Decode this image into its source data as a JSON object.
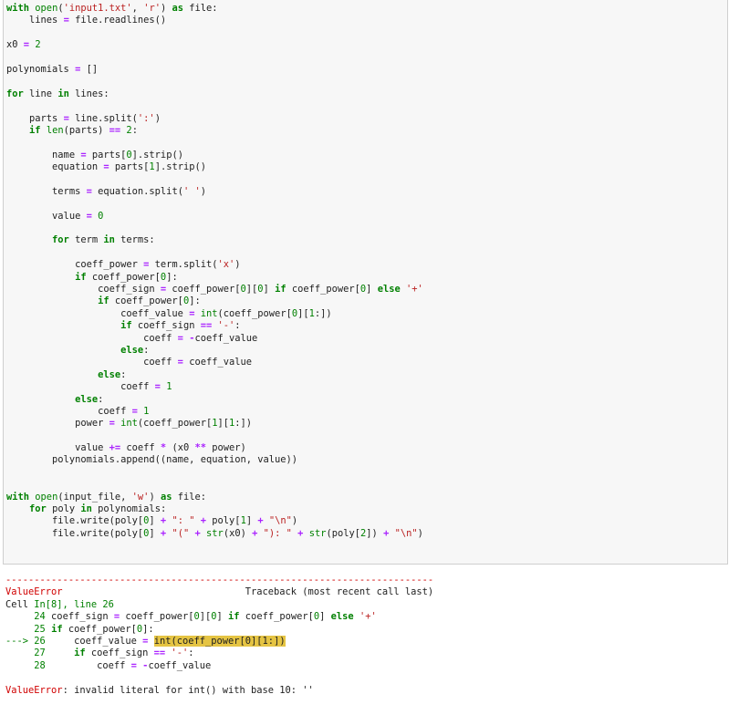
{
  "code_cell": {
    "lines": [
      [
        {
          "t": "kw",
          "v": "with"
        },
        {
          "t": "pl",
          "v": " "
        },
        {
          "t": "bi",
          "v": "open"
        },
        {
          "t": "pl",
          "v": "("
        },
        {
          "t": "str",
          "v": "'input1.txt'"
        },
        {
          "t": "pl",
          "v": ", "
        },
        {
          "t": "str",
          "v": "'r'"
        },
        {
          "t": "pl",
          "v": ") "
        },
        {
          "t": "kw",
          "v": "as"
        },
        {
          "t": "pl",
          "v": " file:"
        }
      ],
      [
        {
          "t": "pl",
          "v": "    lines "
        },
        {
          "t": "op",
          "v": "="
        },
        {
          "t": "pl",
          "v": " file.readlines()"
        }
      ],
      [],
      [
        {
          "t": "pl",
          "v": "x0 "
        },
        {
          "t": "op",
          "v": "="
        },
        {
          "t": "pl",
          "v": " "
        },
        {
          "t": "num",
          "v": "2"
        }
      ],
      [],
      [
        {
          "t": "pl",
          "v": "polynomials "
        },
        {
          "t": "op",
          "v": "="
        },
        {
          "t": "pl",
          "v": " []"
        }
      ],
      [],
      [
        {
          "t": "kw",
          "v": "for"
        },
        {
          "t": "pl",
          "v": " line "
        },
        {
          "t": "kw",
          "v": "in"
        },
        {
          "t": "pl",
          "v": " lines:"
        }
      ],
      [],
      [
        {
          "t": "pl",
          "v": "    parts "
        },
        {
          "t": "op",
          "v": "="
        },
        {
          "t": "pl",
          "v": " line.split("
        },
        {
          "t": "str",
          "v": "':'"
        },
        {
          "t": "pl",
          "v": ")"
        }
      ],
      [
        {
          "t": "pl",
          "v": "    "
        },
        {
          "t": "kw",
          "v": "if"
        },
        {
          "t": "pl",
          "v": " "
        },
        {
          "t": "bi",
          "v": "len"
        },
        {
          "t": "pl",
          "v": "(parts) "
        },
        {
          "t": "op",
          "v": "=="
        },
        {
          "t": "pl",
          "v": " "
        },
        {
          "t": "num",
          "v": "2"
        },
        {
          "t": "pl",
          "v": ":"
        }
      ],
      [],
      [
        {
          "t": "pl",
          "v": "        name "
        },
        {
          "t": "op",
          "v": "="
        },
        {
          "t": "pl",
          "v": " parts["
        },
        {
          "t": "num",
          "v": "0"
        },
        {
          "t": "pl",
          "v": "].strip()"
        }
      ],
      [
        {
          "t": "pl",
          "v": "        equation "
        },
        {
          "t": "op",
          "v": "="
        },
        {
          "t": "pl",
          "v": " parts["
        },
        {
          "t": "num",
          "v": "1"
        },
        {
          "t": "pl",
          "v": "].strip()"
        }
      ],
      [],
      [
        {
          "t": "pl",
          "v": "        terms "
        },
        {
          "t": "op",
          "v": "="
        },
        {
          "t": "pl",
          "v": " equation.split("
        },
        {
          "t": "str",
          "v": "' '"
        },
        {
          "t": "pl",
          "v": ")"
        }
      ],
      [],
      [
        {
          "t": "pl",
          "v": "        value "
        },
        {
          "t": "op",
          "v": "="
        },
        {
          "t": "pl",
          "v": " "
        },
        {
          "t": "num",
          "v": "0"
        }
      ],
      [],
      [
        {
          "t": "pl",
          "v": "        "
        },
        {
          "t": "kw",
          "v": "for"
        },
        {
          "t": "pl",
          "v": " term "
        },
        {
          "t": "kw",
          "v": "in"
        },
        {
          "t": "pl",
          "v": " terms:"
        }
      ],
      [],
      [
        {
          "t": "pl",
          "v": "            coeff_power "
        },
        {
          "t": "op",
          "v": "="
        },
        {
          "t": "pl",
          "v": " term.split("
        },
        {
          "t": "str",
          "v": "'x'"
        },
        {
          "t": "pl",
          "v": ")"
        }
      ],
      [
        {
          "t": "pl",
          "v": "            "
        },
        {
          "t": "kw",
          "v": "if"
        },
        {
          "t": "pl",
          "v": " coeff_power["
        },
        {
          "t": "num",
          "v": "0"
        },
        {
          "t": "pl",
          "v": "]:"
        }
      ],
      [
        {
          "t": "pl",
          "v": "                coeff_sign "
        },
        {
          "t": "op",
          "v": "="
        },
        {
          "t": "pl",
          "v": " coeff_power["
        },
        {
          "t": "num",
          "v": "0"
        },
        {
          "t": "pl",
          "v": "]["
        },
        {
          "t": "num",
          "v": "0"
        },
        {
          "t": "pl",
          "v": "] "
        },
        {
          "t": "kw",
          "v": "if"
        },
        {
          "t": "pl",
          "v": " coeff_power["
        },
        {
          "t": "num",
          "v": "0"
        },
        {
          "t": "pl",
          "v": "] "
        },
        {
          "t": "kw",
          "v": "else"
        },
        {
          "t": "pl",
          "v": " "
        },
        {
          "t": "str",
          "v": "'+'"
        }
      ],
      [
        {
          "t": "pl",
          "v": "                "
        },
        {
          "t": "kw",
          "v": "if"
        },
        {
          "t": "pl",
          "v": " coeff_power["
        },
        {
          "t": "num",
          "v": "0"
        },
        {
          "t": "pl",
          "v": "]:"
        }
      ],
      [
        {
          "t": "pl",
          "v": "                    coeff_value "
        },
        {
          "t": "op",
          "v": "="
        },
        {
          "t": "pl",
          "v": " "
        },
        {
          "t": "bi",
          "v": "int"
        },
        {
          "t": "pl",
          "v": "(coeff_power["
        },
        {
          "t": "num",
          "v": "0"
        },
        {
          "t": "pl",
          "v": "]["
        },
        {
          "t": "num",
          "v": "1"
        },
        {
          "t": "pl",
          "v": ":])"
        }
      ],
      [
        {
          "t": "pl",
          "v": "                    "
        },
        {
          "t": "kw",
          "v": "if"
        },
        {
          "t": "pl",
          "v": " coeff_sign "
        },
        {
          "t": "op",
          "v": "=="
        },
        {
          "t": "pl",
          "v": " "
        },
        {
          "t": "str",
          "v": "'-'"
        },
        {
          "t": "pl",
          "v": ":"
        }
      ],
      [
        {
          "t": "pl",
          "v": "                        coeff "
        },
        {
          "t": "op",
          "v": "="
        },
        {
          "t": "pl",
          "v": " "
        },
        {
          "t": "op",
          "v": "-"
        },
        {
          "t": "pl",
          "v": "coeff_value"
        }
      ],
      [
        {
          "t": "pl",
          "v": "                    "
        },
        {
          "t": "kw",
          "v": "else"
        },
        {
          "t": "pl",
          "v": ":"
        }
      ],
      [
        {
          "t": "pl",
          "v": "                        coeff "
        },
        {
          "t": "op",
          "v": "="
        },
        {
          "t": "pl",
          "v": " coeff_value"
        }
      ],
      [
        {
          "t": "pl",
          "v": "                "
        },
        {
          "t": "kw",
          "v": "else"
        },
        {
          "t": "pl",
          "v": ":"
        }
      ],
      [
        {
          "t": "pl",
          "v": "                    coeff "
        },
        {
          "t": "op",
          "v": "="
        },
        {
          "t": "pl",
          "v": " "
        },
        {
          "t": "num",
          "v": "1"
        }
      ],
      [
        {
          "t": "pl",
          "v": "            "
        },
        {
          "t": "kw",
          "v": "else"
        },
        {
          "t": "pl",
          "v": ":"
        }
      ],
      [
        {
          "t": "pl",
          "v": "                coeff "
        },
        {
          "t": "op",
          "v": "="
        },
        {
          "t": "pl",
          "v": " "
        },
        {
          "t": "num",
          "v": "1"
        }
      ],
      [
        {
          "t": "pl",
          "v": "            power "
        },
        {
          "t": "op",
          "v": "="
        },
        {
          "t": "pl",
          "v": " "
        },
        {
          "t": "bi",
          "v": "int"
        },
        {
          "t": "pl",
          "v": "(coeff_power["
        },
        {
          "t": "num",
          "v": "1"
        },
        {
          "t": "pl",
          "v": "]["
        },
        {
          "t": "num",
          "v": "1"
        },
        {
          "t": "pl",
          "v": ":])"
        }
      ],
      [],
      [
        {
          "t": "pl",
          "v": "            value "
        },
        {
          "t": "op",
          "v": "+="
        },
        {
          "t": "pl",
          "v": " coeff "
        },
        {
          "t": "op",
          "v": "*"
        },
        {
          "t": "pl",
          "v": " (x0 "
        },
        {
          "t": "op",
          "v": "**"
        },
        {
          "t": "pl",
          "v": " power)"
        }
      ],
      [
        {
          "t": "pl",
          "v": "        polynomials.append((name, equation, value))"
        }
      ],
      [],
      [],
      [
        {
          "t": "kw",
          "v": "with"
        },
        {
          "t": "pl",
          "v": " "
        },
        {
          "t": "bi",
          "v": "open"
        },
        {
          "t": "pl",
          "v": "(input_file, "
        },
        {
          "t": "str",
          "v": "'w'"
        },
        {
          "t": "pl",
          "v": ") "
        },
        {
          "t": "kw",
          "v": "as"
        },
        {
          "t": "pl",
          "v": " file:"
        }
      ],
      [
        {
          "t": "pl",
          "v": "    "
        },
        {
          "t": "kw",
          "v": "for"
        },
        {
          "t": "pl",
          "v": " poly "
        },
        {
          "t": "kw",
          "v": "in"
        },
        {
          "t": "pl",
          "v": " polynomials:"
        }
      ],
      [
        {
          "t": "pl",
          "v": "        file.write(poly["
        },
        {
          "t": "num",
          "v": "0"
        },
        {
          "t": "pl",
          "v": "] "
        },
        {
          "t": "op",
          "v": "+"
        },
        {
          "t": "pl",
          "v": " "
        },
        {
          "t": "str",
          "v": "\": \""
        },
        {
          "t": "pl",
          "v": " "
        },
        {
          "t": "op",
          "v": "+"
        },
        {
          "t": "pl",
          "v": " poly["
        },
        {
          "t": "num",
          "v": "1"
        },
        {
          "t": "pl",
          "v": "] "
        },
        {
          "t": "op",
          "v": "+"
        },
        {
          "t": "pl",
          "v": " "
        },
        {
          "t": "str",
          "v": "\"\\n\""
        },
        {
          "t": "pl",
          "v": ")"
        }
      ],
      [
        {
          "t": "pl",
          "v": "        file.write(poly["
        },
        {
          "t": "num",
          "v": "0"
        },
        {
          "t": "pl",
          "v": "] "
        },
        {
          "t": "op",
          "v": "+"
        },
        {
          "t": "pl",
          "v": " "
        },
        {
          "t": "str",
          "v": "\"(\""
        },
        {
          "t": "pl",
          "v": " "
        },
        {
          "t": "op",
          "v": "+"
        },
        {
          "t": "pl",
          "v": " "
        },
        {
          "t": "bi",
          "v": "str"
        },
        {
          "t": "pl",
          "v": "(x0) "
        },
        {
          "t": "op",
          "v": "+"
        },
        {
          "t": "pl",
          "v": " "
        },
        {
          "t": "str",
          "v": "\"): \""
        },
        {
          "t": "pl",
          "v": " "
        },
        {
          "t": "op",
          "v": "+"
        },
        {
          "t": "pl",
          "v": " "
        },
        {
          "t": "bi",
          "v": "str"
        },
        {
          "t": "pl",
          "v": "(poly["
        },
        {
          "t": "num",
          "v": "2"
        },
        {
          "t": "pl",
          "v": "]) "
        },
        {
          "t": "op",
          "v": "+"
        },
        {
          "t": "pl",
          "v": " "
        },
        {
          "t": "str",
          "v": "\"\\n\""
        },
        {
          "t": "pl",
          "v": ")"
        }
      ]
    ]
  },
  "output": {
    "lines": [
      [
        {
          "t": "red",
          "v": "---------------------------------------------------------------------------"
        }
      ],
      [
        {
          "t": "red",
          "v": "ValueError"
        },
        {
          "t": "pl",
          "v": "                                Traceback (most recent call last)"
        }
      ],
      [
        {
          "t": "pl",
          "v": "Cell "
        },
        {
          "t": "grn",
          "v": "In[8], line 26"
        }
      ],
      [
        {
          "t": "grn",
          "v": "     24"
        },
        {
          "t": "pl",
          "v": " coeff_sign "
        },
        {
          "t": "op",
          "v": "="
        },
        {
          "t": "pl",
          "v": " coeff_power["
        },
        {
          "t": "num",
          "v": "0"
        },
        {
          "t": "pl",
          "v": "]["
        },
        {
          "t": "num",
          "v": "0"
        },
        {
          "t": "pl",
          "v": "] "
        },
        {
          "t": "kw",
          "v": "if"
        },
        {
          "t": "pl",
          "v": " coeff_power["
        },
        {
          "t": "num",
          "v": "0"
        },
        {
          "t": "pl",
          "v": "] "
        },
        {
          "t": "kw",
          "v": "else"
        },
        {
          "t": "pl",
          "v": " "
        },
        {
          "t": "str",
          "v": "'+'"
        }
      ],
      [
        {
          "t": "grn",
          "v": "     25"
        },
        {
          "t": "pl",
          "v": " "
        },
        {
          "t": "kw",
          "v": "if"
        },
        {
          "t": "pl",
          "v": " coeff_power["
        },
        {
          "t": "num",
          "v": "0"
        },
        {
          "t": "pl",
          "v": "]:"
        }
      ],
      [
        {
          "t": "grn",
          "v": "---> 26"
        },
        {
          "t": "pl",
          "v": "     coeff_value "
        },
        {
          "t": "op",
          "v": "="
        },
        {
          "t": "pl",
          "v": " "
        },
        {
          "t": "hl",
          "v": "int(coeff_power[0][1:])"
        }
      ],
      [
        {
          "t": "grn",
          "v": "     27"
        },
        {
          "t": "pl",
          "v": "     "
        },
        {
          "t": "kw",
          "v": "if"
        },
        {
          "t": "pl",
          "v": " coeff_sign "
        },
        {
          "t": "op",
          "v": "=="
        },
        {
          "t": "pl",
          "v": " "
        },
        {
          "t": "str",
          "v": "'-'"
        },
        {
          "t": "pl",
          "v": ":"
        }
      ],
      [
        {
          "t": "grn",
          "v": "     28"
        },
        {
          "t": "pl",
          "v": "         coeff "
        },
        {
          "t": "op",
          "v": "="
        },
        {
          "t": "pl",
          "v": " "
        },
        {
          "t": "op",
          "v": "-"
        },
        {
          "t": "pl",
          "v": "coeff_value"
        }
      ],
      [],
      [
        {
          "t": "red",
          "v": "ValueError"
        },
        {
          "t": "pl",
          "v": ": invalid literal for int() with base 10: ''"
        }
      ]
    ]
  }
}
